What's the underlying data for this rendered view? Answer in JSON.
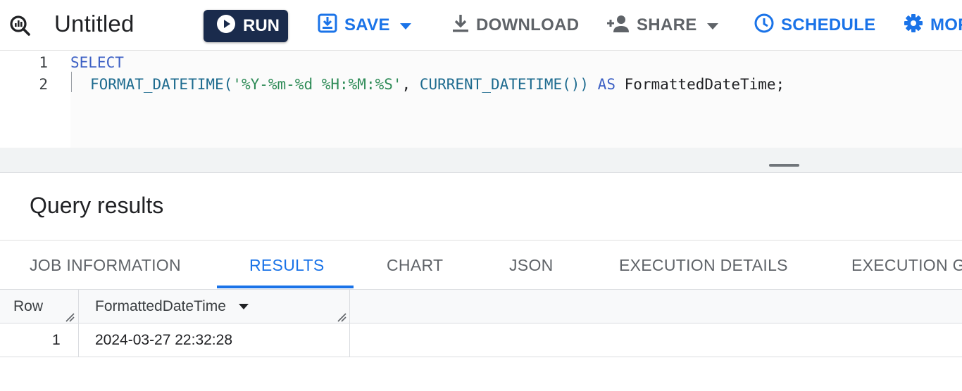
{
  "toolbar": {
    "title": "Untitled",
    "run_label": "RUN",
    "save_label": "SAVE",
    "download_label": "DOWNLOAD",
    "share_label": "SHARE",
    "schedule_label": "SCHEDULE",
    "more_label": "MOR"
  },
  "editor": {
    "line_numbers": [
      "1",
      "2"
    ],
    "line1": {
      "kw": "SELECT"
    },
    "line2": {
      "fn1": "FORMAT_DATETIME(",
      "str": "'%Y-%m-%d %H:%M:%S'",
      "sep": ", ",
      "fn2": "CURRENT_DATETIME())",
      "kw": " AS ",
      "alias": "FormattedDateTime;"
    }
  },
  "results": {
    "title": "Query results",
    "tabs": [
      "JOB INFORMATION",
      "RESULTS",
      "CHART",
      "JSON",
      "EXECUTION DETAILS",
      "EXECUTION G"
    ],
    "active_tab": "RESULTS",
    "columns": [
      "Row",
      "FormattedDateTime"
    ],
    "rows": [
      {
        "row": "1",
        "FormattedDateTime": "2024-03-27 22:32:28"
      }
    ]
  },
  "colors": {
    "accent": "#1a73e8",
    "run_button": "#1a2b4c",
    "keyword": "#3b5fc4",
    "string": "#2e8b57"
  },
  "icons": {
    "query": "query-search-icon",
    "run": "play-circle-icon",
    "save": "save-icon",
    "download": "download-icon",
    "share": "person-add-icon",
    "schedule": "clock-icon",
    "more": "gear-icon"
  }
}
